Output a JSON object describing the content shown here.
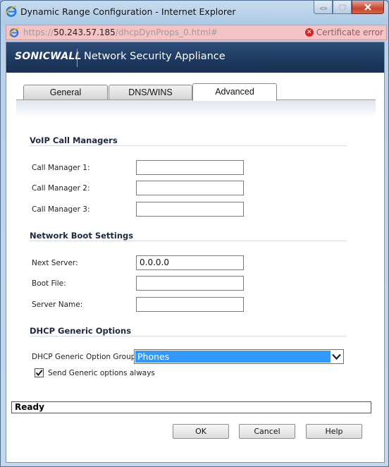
{
  "window": {
    "title": "Dynamic Range Configuration - Internet Explorer",
    "controls": {
      "minimize": "minimize-icon",
      "maximize": "maximize-icon",
      "close": "close-icon"
    }
  },
  "address_bar": {
    "scheme": "https://",
    "host": "50.243.57.185",
    "path": "/dhcpDynProps_0.html#",
    "certificate_error": "Certificate error",
    "background_color": "#f4c3c6"
  },
  "banner": {
    "logo": "SONICWALL",
    "title": "Network Security Appliance",
    "color": "#1e3a61"
  },
  "tabs": [
    {
      "label": "General",
      "active": false
    },
    {
      "label": "DNS/WINS",
      "active": false
    },
    {
      "label": "Advanced",
      "active": true
    }
  ],
  "voip": {
    "heading": "VoIP Call Managers",
    "fields": [
      {
        "label": "Call Manager 1:",
        "value": ""
      },
      {
        "label": "Call Manager 2:",
        "value": ""
      },
      {
        "label": "Call Manager 3:",
        "value": ""
      }
    ]
  },
  "network_boot": {
    "heading": "Network Boot Settings",
    "fields": [
      {
        "label": "Next Server:",
        "value": "0.0.0.0"
      },
      {
        "label": "Boot File:",
        "value": ""
      },
      {
        "label": "Server Name:",
        "value": ""
      }
    ]
  },
  "dhcp_generic": {
    "heading": "DHCP Generic Options",
    "group_label": "DHCP Generic Option Group:",
    "group_value": "Phones",
    "checkbox_label": "Send Generic options always",
    "checkbox_checked": true,
    "selection_color": "#3399ff"
  },
  "status": {
    "text": "Ready"
  },
  "buttons": {
    "ok": "OK",
    "cancel": "Cancel",
    "help": "Help"
  }
}
